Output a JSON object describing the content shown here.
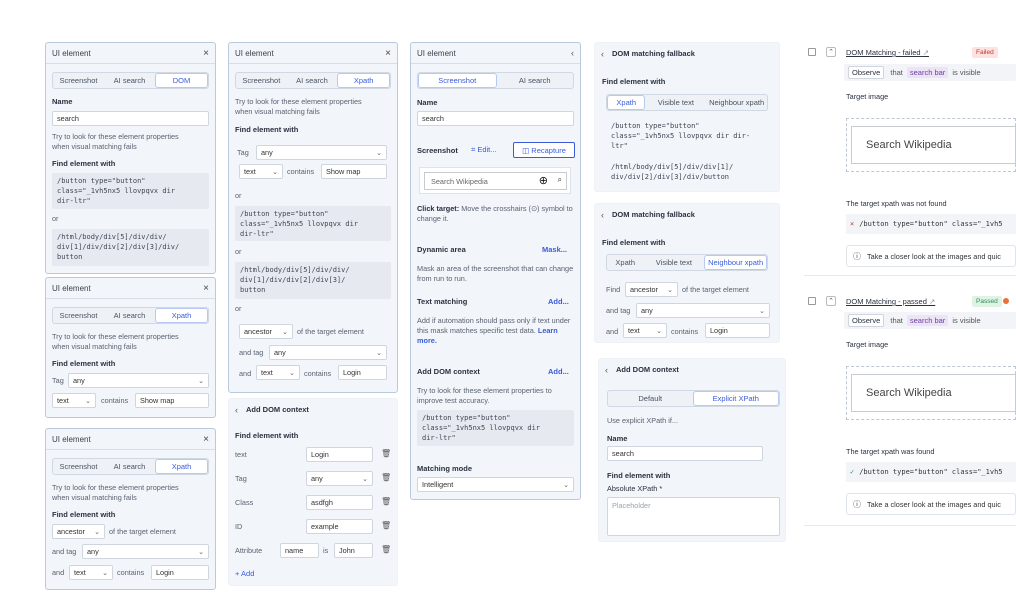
{
  "colors": {
    "accent": "#3b5bdb",
    "panel_border": "#bac9dc",
    "panel_bg": "#f2f5f9",
    "fail": "#c0392b",
    "pass": "#2e8b57"
  },
  "common": {
    "ui_element": "UI element",
    "screenshot_tab": "Screenshot",
    "ai_search_tab": "AI search",
    "dom_tab": "DOM",
    "xpath_tab": "Xpath",
    "name": "Name",
    "search_value": "search",
    "hint": "Try to look for these element properties when visual matching fails",
    "find_with": "Find element with",
    "or": "or",
    "button_code": "/button type=\"button\"\nclass=\"_1vh5nx5 llovpqvx dir\ndir-ltr\"",
    "xpath_code": "/html/body/div[5]/div/div/\ndiv[1]/div/div[2]/div[3]/div/\nbutton",
    "tag": "Tag",
    "any": "any",
    "text": "text",
    "contains": "contains",
    "show_map": "Show map",
    "ancestor": "ancestor",
    "of_target": "of the target element",
    "and_tag": "and tag",
    "and": "and",
    "login": "Login",
    "close": "×",
    "chevron_down": "⌄",
    "chevron_up": "⌃",
    "back": "‹"
  },
  "p1": {
    "hint_line1": "Try to look for these element properties",
    "hint_line2": "when visual matching fails"
  },
  "p4": {
    "xpath_code": "/html/body/div[5]/div/div/\ndiv[1]/div/div[2]/div[3]/\nbutton"
  },
  "p5": {
    "title": "Add DOM context",
    "class": "Class",
    "class_val": "asdfgh",
    "id": "ID",
    "id_val": "example",
    "attribute": "Attribute",
    "attr_name": "name",
    "is": "is",
    "attr_val": "John",
    "add": "+ Add"
  },
  "p6": {
    "screenshot": "Screenshot",
    "edit": "Edit...",
    "recapture": "Recapture",
    "search_wikipedia": "Search Wikipedia",
    "click_target_b": "Click target:",
    "click_target": " Move the crosshairs (⊙) symbol to change it.",
    "dynamic_area": "Dynamic area",
    "mask": "Mask...",
    "mask_hint": "Mask an area of the screenshot that can change from run to run.",
    "text_matching": "Text matching",
    "add_link": "Add...",
    "text_hint": "Add if automation should pass only if text under this mask matches specific test data.",
    "learn_more": "Learn more.",
    "add_dom_context": "Add DOM context",
    "dom_hint": "Try to look for these element properties to improve test accuracy.",
    "matching_mode": "Matching mode",
    "intelligent": "Intelligent"
  },
  "fb": {
    "title": "DOM matching fallback",
    "visible_text": "Visible text",
    "neighbour_xpath": "Neighbour xpath",
    "code1": "/button type=\"button\"\nclass=\"_1vh5nx5 llovpqvx dir dir-\nltr\"",
    "code2": "/html/body/div[5]/div/div[1]/\ndiv/div[2]/div[3]/div/button",
    "find": "Find",
    "and_tag": "and tag"
  },
  "ctx": {
    "title": "Add DOM context",
    "default": "Default",
    "explicit": "Explicit XPath",
    "use_explicit": "Use explicit XPath if...",
    "absolute": "Absolute XPath *",
    "placeholder": "Placeholder"
  },
  "res1": {
    "title": "DOM Matching - failed",
    "ext": "↗",
    "badge": "Failed",
    "observe": "Observe",
    "that": "that",
    "search_bar": "search bar",
    "is_visible": "is visible",
    "target_image": "Target image",
    "wiki": "Search Wikipedia",
    "status": "The target xpath was not found",
    "code": "/button type=\"button\" class=\"_1vh5",
    "tip": "Take a closer look at the images and quic"
  },
  "res2": {
    "title": "DOM Matching - passed",
    "badge": "Passed",
    "status": "The target xpath was found",
    "code": "/button type=\"button\" class=\"_1vh5",
    "tip": "Take a closer look at the images and quic"
  }
}
